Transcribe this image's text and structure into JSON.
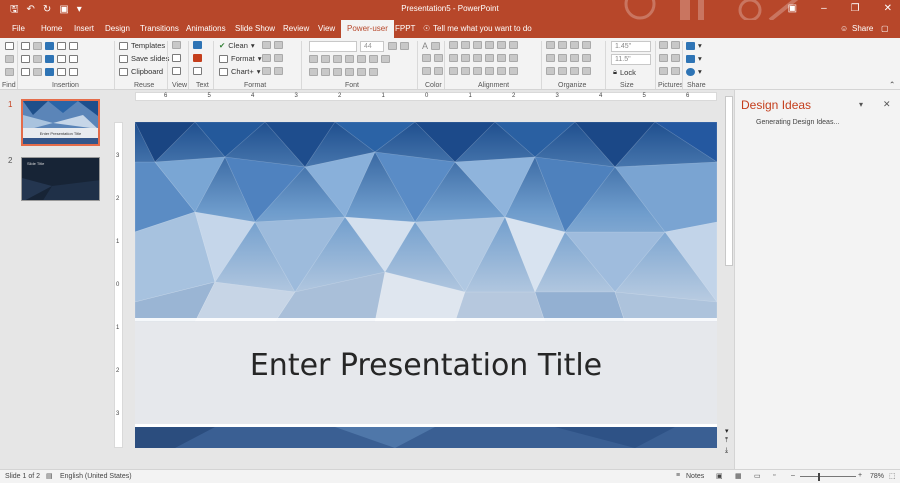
{
  "window": {
    "title": "Presentation5 - PowerPoint",
    "accent": "#b7472a"
  },
  "qat": {
    "save_icon": "save-icon",
    "undo_icon": "undo-icon",
    "redo_icon": "redo-icon",
    "present_icon": "present-icon",
    "more_icon": "customize-icon"
  },
  "tabs": [
    {
      "label": "File"
    },
    {
      "label": "Home"
    },
    {
      "label": "Insert"
    },
    {
      "label": "Design"
    },
    {
      "label": "Transitions"
    },
    {
      "label": "Animations"
    },
    {
      "label": "Slide Show"
    },
    {
      "label": "Review"
    },
    {
      "label": "View"
    },
    {
      "label": "Power-user",
      "active": true
    },
    {
      "label": "FPPT"
    }
  ],
  "tell_me": "Tell me what you want to do",
  "share_label": "Share",
  "ribbon": {
    "groups": [
      "Find",
      "Insertion",
      "Reuse",
      "View",
      "Text",
      "Format",
      "Font",
      "Color",
      "Alignment",
      "Organize",
      "Size",
      "Pictures",
      "Share"
    ],
    "templates_label": "Templates",
    "save_slides_label": "Save slides",
    "clipboard_label": "Clipboard",
    "clean_label": "Clean",
    "format_label": "Format",
    "chart_label": "Chart+",
    "font_size_value": "44",
    "width_value": "1.45\"",
    "height_value": "11.5\"",
    "lock_label": "Lock"
  },
  "slides": {
    "numbers": [
      "1",
      "2"
    ],
    "thumb1_caption": "Enter Presentation Title",
    "thumb2_caption": "Slide Title"
  },
  "slide": {
    "title": "Enter Presentation Title"
  },
  "ruler": {
    "h_ticks": [
      "6",
      "5",
      "4",
      "3",
      "2",
      "1",
      "0",
      "1",
      "2",
      "3",
      "4",
      "5",
      "6"
    ],
    "v_ticks": [
      "3",
      "2",
      "1",
      "0",
      "1",
      "2",
      "3"
    ]
  },
  "design_ideas": {
    "title": "Design Ideas",
    "status": "Generating Design Ideas..."
  },
  "status": {
    "slide_of": "Slide 1 of 2",
    "language": "English (United States)",
    "notes": "Notes",
    "zoom": "78%"
  }
}
